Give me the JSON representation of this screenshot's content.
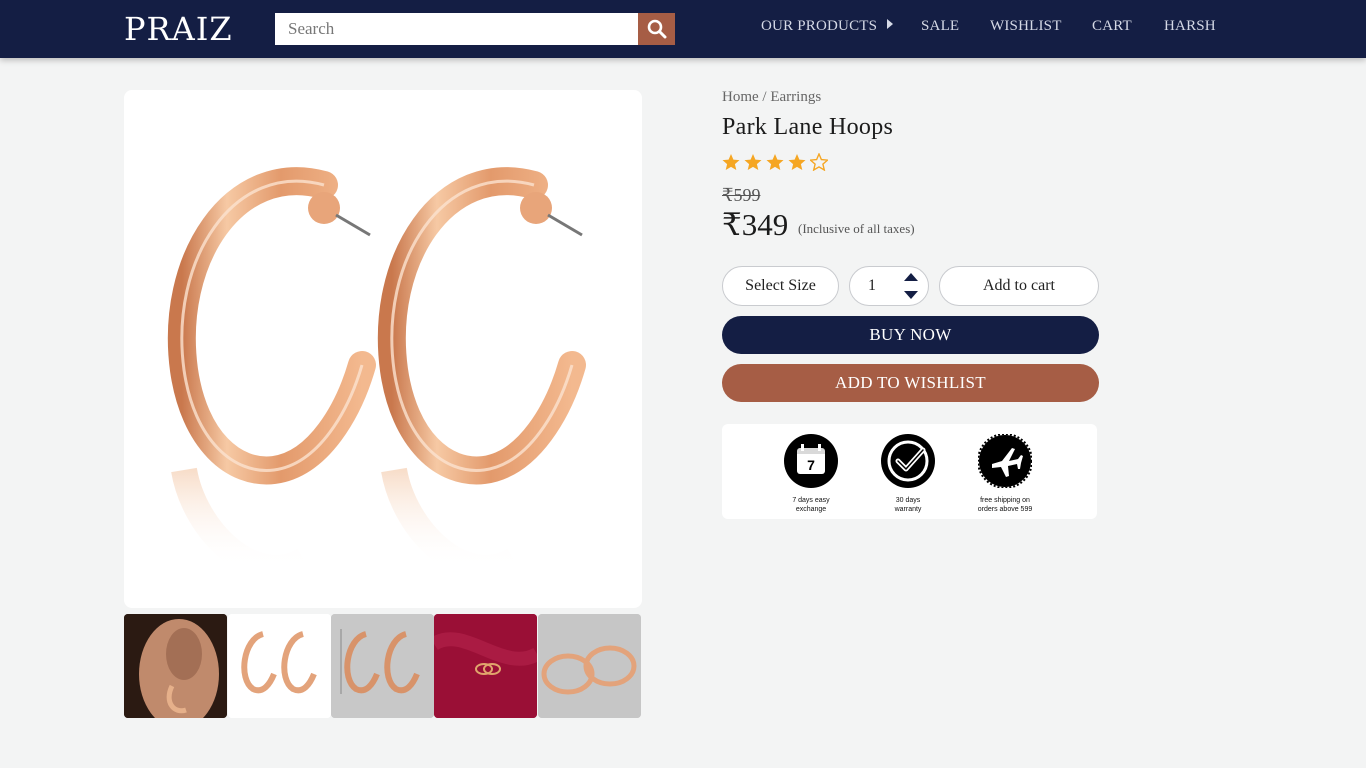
{
  "header": {
    "logo": "PRAIZ",
    "search_placeholder": "Search",
    "nav": {
      "products": "OUR PRODUCTS",
      "sale": "SALE",
      "wishlist": "WISHLIST",
      "cart": "CART",
      "user": "HARSH"
    }
  },
  "breadcrumb": {
    "home": "Home",
    "separator": " / ",
    "category": "Earrings"
  },
  "product": {
    "title": "Park Lane Hoops",
    "rating": 4,
    "rating_max": 5,
    "mrp": "₹599",
    "price": "₹349",
    "tax_note": "(Inclusive of all taxes)"
  },
  "controls": {
    "select_size": "Select Size",
    "quantity": "1",
    "add_to_cart": "Add to cart",
    "buy_now": "BUY NOW",
    "add_to_wishlist": "ADD TO WISHLIST"
  },
  "perks": [
    {
      "icon": "calendar-icon",
      "badge_text": "7",
      "caption_line1": "7 days easy",
      "caption_line2": "exchange"
    },
    {
      "icon": "warranty-check-icon",
      "badge_text": "",
      "caption_line1": "30  days",
      "caption_line2": "warranty"
    },
    {
      "icon": "airplane-icon",
      "badge_text": "",
      "caption_line1": "free shipping on",
      "caption_line2": "orders above 599"
    }
  ],
  "colors": {
    "navy": "#141e44",
    "accent": "#a65d45",
    "star": "#f5a623",
    "gold": "#e3a37b"
  }
}
